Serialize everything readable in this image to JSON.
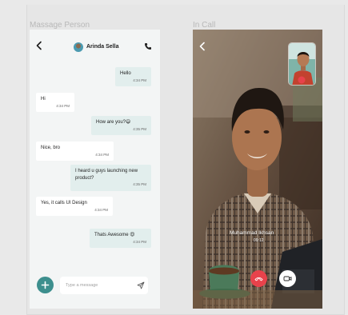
{
  "sections": {
    "message_title": "Massage Person",
    "call_title": "In Call"
  },
  "chat": {
    "contact_name": "Arinda Sella",
    "messages": [
      {
        "side": "sent",
        "text": "Hello",
        "time": "4:34 PM"
      },
      {
        "side": "received",
        "text": "Hi",
        "time": "4:34 PM"
      },
      {
        "side": "sent",
        "text": "How are you?😄",
        "time": "4:35 PM"
      },
      {
        "side": "received",
        "text": "Nice, bro",
        "time": "4:34 PM"
      },
      {
        "side": "sent",
        "text": "I heard u guys launching new product?",
        "time": "4:35 PM"
      },
      {
        "side": "received",
        "text": "Yes, it calls UI Design",
        "time": "4:34 PM"
      },
      {
        "side": "sent",
        "text": "Thats Awesome 😍",
        "time": "4:34 PM"
      }
    ],
    "input_placeholder": "Type a message",
    "icons": {
      "back": "back-arrow-icon",
      "call": "phone-icon",
      "add": "plus-icon",
      "send": "send-icon"
    }
  },
  "call": {
    "caller_name": "Muhammad Ikhsan",
    "duration": "09:12",
    "icons": {
      "back": "back-arrow-icon",
      "end": "end-call-icon",
      "video": "video-camera-icon"
    }
  },
  "colors": {
    "accent": "#3d8f8e",
    "sent_bubble": "#e2eeed",
    "end_call": "#e8424b"
  }
}
